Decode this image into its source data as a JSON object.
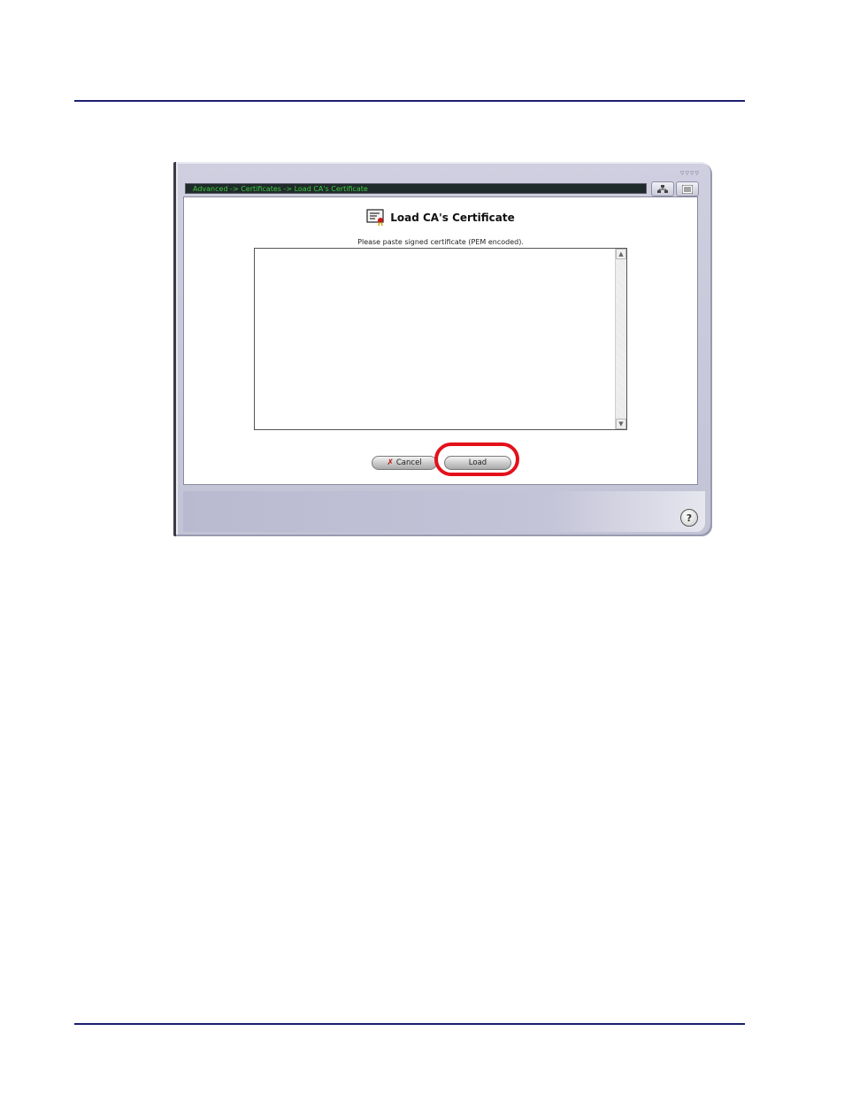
{
  "breadcrumb": "Advanced -> Certificates -> Load CA's Certificate",
  "toolbar": {
    "sitemap_icon": "sitemap-icon",
    "menu_icon": "menu-icon"
  },
  "title": "Load CA's Certificate",
  "title_icon": "certificate-icon",
  "instruction": "Please paste signed certificate (PEM encoded).",
  "certificate_input": {
    "value": "",
    "placeholder": ""
  },
  "buttons": {
    "cancel_label": "Cancel",
    "cancel_icon": "x-icon",
    "load_label": "Load"
  },
  "help_label": "?",
  "colors": {
    "highlight": "#e3101a",
    "breadcrumb_text": "#3ccb3c",
    "rule": "#1b1f6e"
  }
}
